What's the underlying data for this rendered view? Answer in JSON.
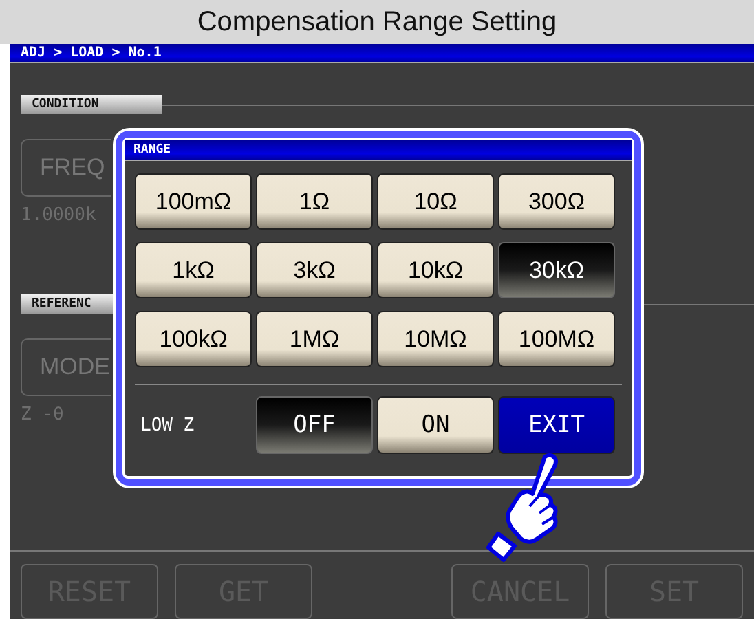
{
  "title": "Compensation Range Setting",
  "breadcrumb": "ADJ > LOAD > No.1",
  "background": {
    "sections": [
      {
        "heading": "CONDITION",
        "button": "FREQ",
        "value": "1.0000k"
      },
      {
        "heading": "REFERENC",
        "button": "MODE",
        "value": "Z -θ"
      }
    ],
    "buttons": [
      {
        "label": "RESET",
        "disabled": true
      },
      {
        "label": "GET",
        "disabled": true
      },
      {
        "label": "CANCEL",
        "disabled": true
      },
      {
        "label": "SET",
        "disabled": true
      }
    ]
  },
  "dialog": {
    "title": "RANGE",
    "ranges": [
      {
        "label": "100mΩ",
        "selected": false
      },
      {
        "label": "1Ω",
        "selected": false
      },
      {
        "label": "10Ω",
        "selected": false
      },
      {
        "label": "300Ω",
        "selected": false
      },
      {
        "label": "1kΩ",
        "selected": false
      },
      {
        "label": "3kΩ",
        "selected": false
      },
      {
        "label": "10kΩ",
        "selected": false
      },
      {
        "label": "30kΩ",
        "selected": true
      },
      {
        "label": "100kΩ",
        "selected": false
      },
      {
        "label": "1MΩ",
        "selected": false
      },
      {
        "label": "10MΩ",
        "selected": false
      },
      {
        "label": "100MΩ",
        "selected": false
      }
    ],
    "low_z": {
      "label": "LOW Z",
      "options": [
        {
          "label": "OFF",
          "selected": true
        },
        {
          "label": "ON",
          "selected": false
        }
      ]
    },
    "exit": "EXIT"
  }
}
